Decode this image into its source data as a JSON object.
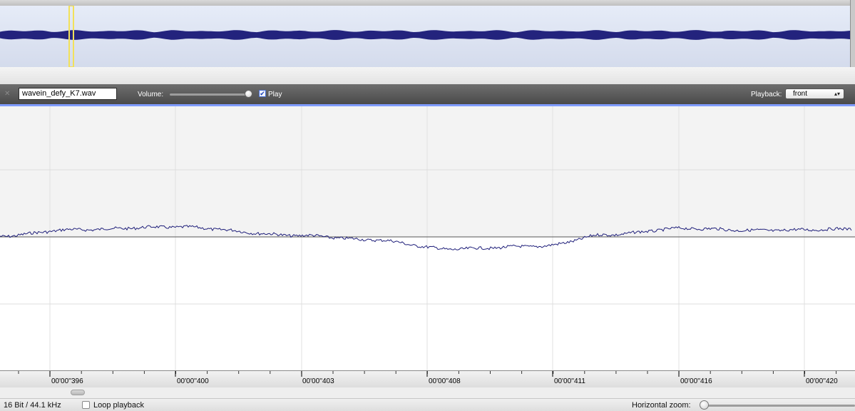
{
  "toolbar": {
    "filename": "wavein_defy_K7.wav",
    "volume_label": "Volume:",
    "volume_level": 0.96,
    "play_label": "Play",
    "play_checked": true,
    "playback_label": "Playback:",
    "playback_value": "front"
  },
  "timeline": {
    "ticks": [
      "00'00''396",
      "00'00''400",
      "00'00''403",
      "00'00''408",
      "00'00''411",
      "00'00''416",
      "00'00''420"
    ]
  },
  "status": {
    "format": "16 Bit / 44.1 kHz",
    "loop_label": "Loop playback",
    "loop_checked": false,
    "zoom_label": "Horizontal zoom:",
    "zoom_level": 0.0
  },
  "colors": {
    "waveform": "#1f1f7a",
    "overview_waveform": "#23237d",
    "selection": "#f2e15a",
    "toolbar_accent": "#7f9bff"
  },
  "icons": {
    "close": "close-icon",
    "checkmark": "checkmark-icon",
    "select_arrows": "updown-arrows-icon"
  }
}
